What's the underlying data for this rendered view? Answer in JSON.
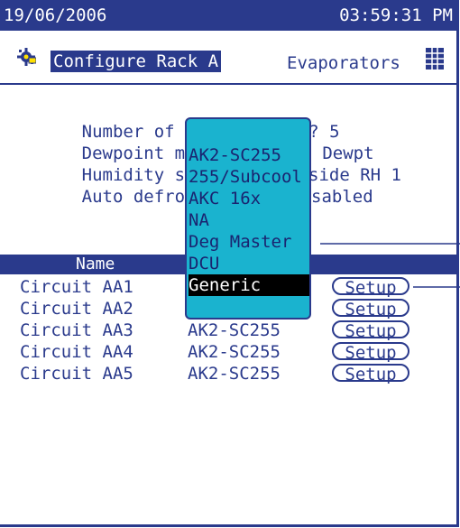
{
  "status_bar": {
    "date": "19/06/2006",
    "time": "03:59:31 PM"
  },
  "header": {
    "rack_title": "Configure Rack A",
    "section": "Evaporators",
    "rack_icon": "gear-hand-icon",
    "section_icon": "grid-icon"
  },
  "settings": [
    {
      "label": "Number of Circuits....? 5"
    },
    {
      "label": "Dewpoint method",
      "value": "lc Dewpt"
    },
    {
      "label": "Humidity sensor",
      "value": "side RH 1"
    },
    {
      "label": "Auto defrost sc",
      "value": "sabled"
    }
  ],
  "list_header": {
    "name": "Name"
  },
  "circuits": [
    {
      "name": "Circuit AA1",
      "type": "",
      "setup": "Setup"
    },
    {
      "name": "Circuit AA2",
      "type": "",
      "setup": "Setup"
    },
    {
      "name": "Circuit AA3",
      "type": "AK2-SC255",
      "setup": "Setup"
    },
    {
      "name": "Circuit AA4",
      "type": "AK2-SC255",
      "setup": "Setup"
    },
    {
      "name": "Circuit AA5",
      "type": "AK2-SC255",
      "setup": "Setup"
    }
  ],
  "dropdown": {
    "options": [
      "AK2-SC255",
      "255/Subcool",
      "AKC 16x",
      "NA",
      "Deg Master",
      "DCU",
      "Generic"
    ],
    "selected": "Generic"
  },
  "colors": {
    "primary": "#2a3a8c",
    "dropdown_bg": "#1ab3cf",
    "selected_bg": "#000000"
  }
}
